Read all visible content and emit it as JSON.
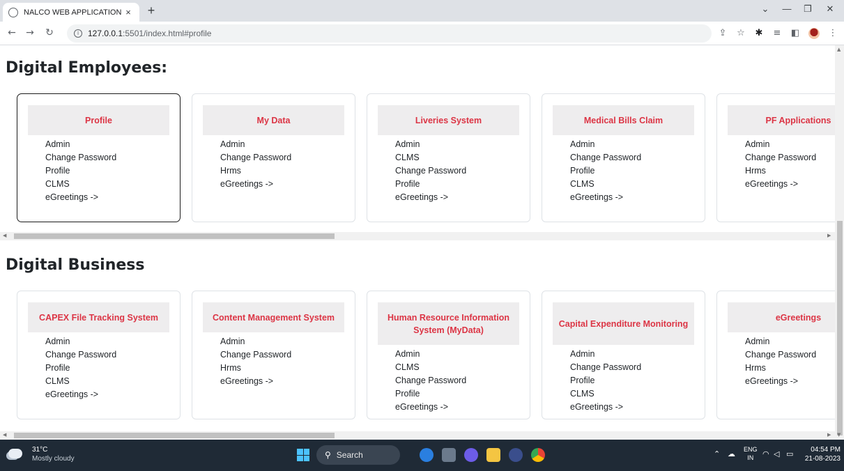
{
  "browser": {
    "tab_title": "NALCO WEB APPLICATION PAGE",
    "tab_close": "×",
    "new_tab": "+",
    "url_host": "127.0.0.1",
    "url_rest": ":5501/index.html#profile"
  },
  "page": {
    "sections": [
      {
        "title": "Digital Employees:",
        "cards": [
          {
            "title": "Profile",
            "items": [
              "Admin",
              "Change Password",
              "Profile",
              "CLMS",
              "eGreetings ->"
            ]
          },
          {
            "title": "My Data",
            "items": [
              "Admin",
              "Change Password",
              "Hrms",
              "eGreetings ->"
            ]
          },
          {
            "title": "Liveries System",
            "items": [
              "Admin",
              "CLMS",
              "Change Password",
              "Profile",
              "eGreetings ->"
            ]
          },
          {
            "title": "Medical Bills Claim",
            "items": [
              "Admin",
              "Change Password",
              "Profile",
              "CLMS",
              "eGreetings ->"
            ]
          },
          {
            "title": "PF Applications",
            "items": [
              "Admin",
              "Change Password",
              "Hrms",
              "eGreetings ->"
            ]
          }
        ]
      },
      {
        "title": "Digital Business",
        "cards": [
          {
            "title": "CAPEX File Tracking System",
            "items": [
              "Admin",
              "Change Password",
              "Profile",
              "CLMS",
              "eGreetings ->"
            ]
          },
          {
            "title": "Content Management System",
            "items": [
              "Admin",
              "Change Password",
              "Hrms",
              "eGreetings ->"
            ]
          },
          {
            "title": "Human Resource Information System (MyData)",
            "items": [
              "Admin",
              "CLMS",
              "Change Password",
              "Profile",
              "eGreetings ->"
            ]
          },
          {
            "title": "Capital Expenditure Monitoring",
            "items": [
              "Admin",
              "Change Password",
              "Profile",
              "CLMS",
              "eGreetings ->"
            ]
          },
          {
            "title": "eGreetings",
            "items": [
              "Admin",
              "Change Password",
              "Hrms",
              "eGreetings ->"
            ]
          }
        ]
      }
    ]
  },
  "taskbar": {
    "weather_temp": "31°C",
    "weather_desc": "Mostly cloudy",
    "search_label": "Search",
    "lang_1": "ENG",
    "lang_2": "IN",
    "time": "04:54 PM",
    "date": "21-08-2023"
  },
  "colors": {
    "card_title": "#dc3545",
    "card_head_bg": "#eeedee",
    "taskbar_bg": "#1f2a36"
  }
}
